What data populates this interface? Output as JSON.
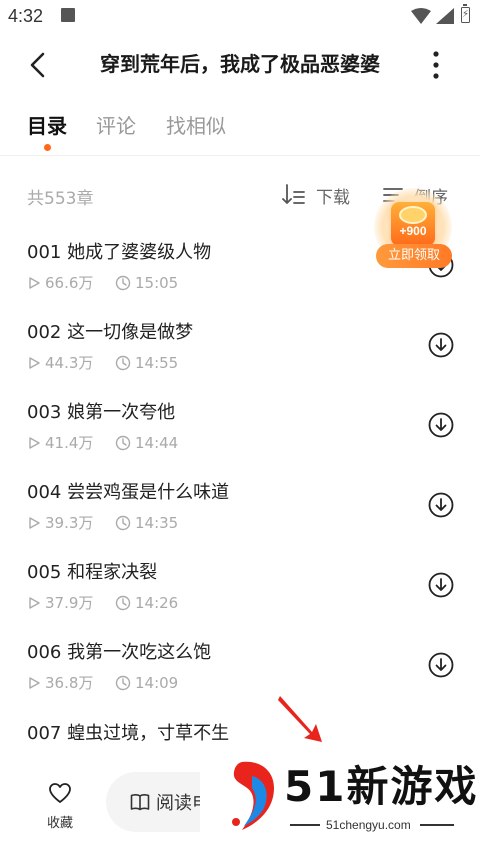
{
  "status_bar": {
    "time": "4:32"
  },
  "header": {
    "title": "穿到荒年后，我成了极品恶婆婆"
  },
  "tabs": [
    {
      "label": "目录",
      "active": true
    },
    {
      "label": "评论",
      "active": false
    },
    {
      "label": "找相似",
      "active": false
    }
  ],
  "meta": {
    "chapter_count": "共553章",
    "download_label": "下载",
    "sort_label": "倒序"
  },
  "chapters": [
    {
      "name": "001 她成了婆婆级人物",
      "views": "66.6万",
      "time": "15:05"
    },
    {
      "name": "002 这一切像是做梦",
      "views": "44.3万",
      "time": "14:55"
    },
    {
      "name": "003 娘第一次夸他",
      "views": "41.4万",
      "time": "14:44"
    },
    {
      "name": "004 尝尝鸡蛋是什么味道",
      "views": "39.3万",
      "time": "14:35"
    },
    {
      "name": "005 和程家决裂",
      "views": "37.9万",
      "time": "14:26"
    },
    {
      "name": "006 我第一次吃这么饱",
      "views": "36.8万",
      "time": "14:09"
    },
    {
      "name": "007 蝗虫过境，寸草不生",
      "views": "",
      "time": ""
    }
  ],
  "promo": {
    "amount": "+900",
    "cta": "立即领取"
  },
  "bottom_bar": {
    "favorite_label": "收藏",
    "read_label": "阅读电"
  },
  "watermark": {
    "brand": "51新游戏",
    "url": "51chengyu.com"
  },
  "colors": {
    "accent": "#ff6a1a",
    "muted_text": "#aaaaaa"
  }
}
